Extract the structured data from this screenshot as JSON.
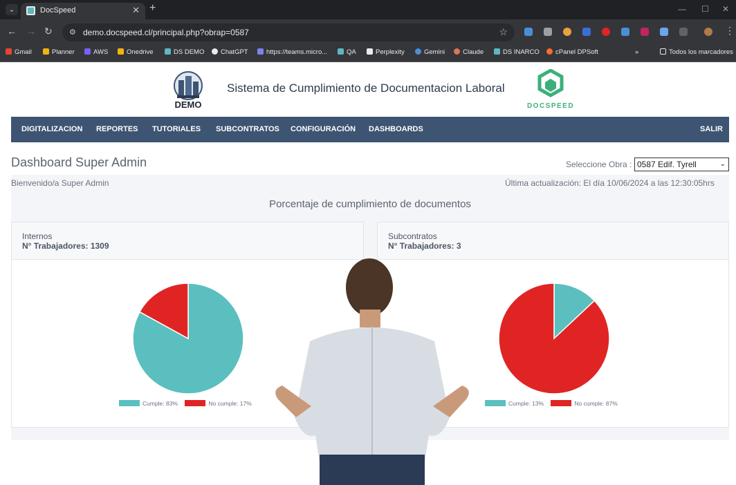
{
  "browser": {
    "tab_title": "DocSpeed",
    "url": "demo.docspeed.cl/principal.php?obrap=0587",
    "bookmarks": [
      "Gmail",
      "Planner",
      "AWS",
      "Onedrive",
      "DS DEMO",
      "ChatGPT",
      "https://teams.micro...",
      "QA",
      "Perplexity",
      "Gemini",
      "Claude",
      "DS INARCO",
      "cPanel DPSoft"
    ],
    "all_bookmarks": "Todos los marcadores"
  },
  "header": {
    "title": "Sistema de Cumplimiento de Documentacion Laboral",
    "demo_logo_text": "DEMO",
    "brand_logo_text": "DOCSPEED"
  },
  "menu": {
    "items": [
      "DIGITALIZACION",
      "REPORTES",
      "TUTORIALES",
      "SUBCONTRATOS",
      "CONFIGURACIÓN",
      "DASHBOARDS"
    ],
    "logout": "SALIR"
  },
  "dashboard": {
    "title": "Dashboard Super Admin",
    "welcome": "Bienvenido/a Super Admin",
    "obra_label": "Seleccione Obra :",
    "obra_selected": "0587 Edif. Tyrell",
    "last_update": "Última actualización: El día 10/06/2024 a las 12:30:05hrs",
    "section_title": "Porcentaje de cumplimiento de documentos"
  },
  "cards": [
    {
      "name": "Internos",
      "count": "N° Trabajadores: 1309",
      "legend_cumple": "Cumple: 83%",
      "legend_no": "No cumple: 17%"
    },
    {
      "name": "Subcontratos",
      "count": "N° Trabajadores: 3",
      "legend_cumple": "Cumple: 13%",
      "legend_no": "No cumple: 87%"
    }
  ],
  "colors": {
    "cumple": "#5bbfbf",
    "no_cumple": "#e02424",
    "menubar": "#3d5472"
  },
  "chart_data": [
    {
      "type": "pie",
      "categories": [
        "Cumple",
        "No cumple"
      ],
      "values": [
        83,
        17
      ]
    },
    {
      "type": "pie",
      "categories": [
        "Cumple",
        "No cumple"
      ],
      "values": [
        13,
        87
      ]
    }
  ]
}
